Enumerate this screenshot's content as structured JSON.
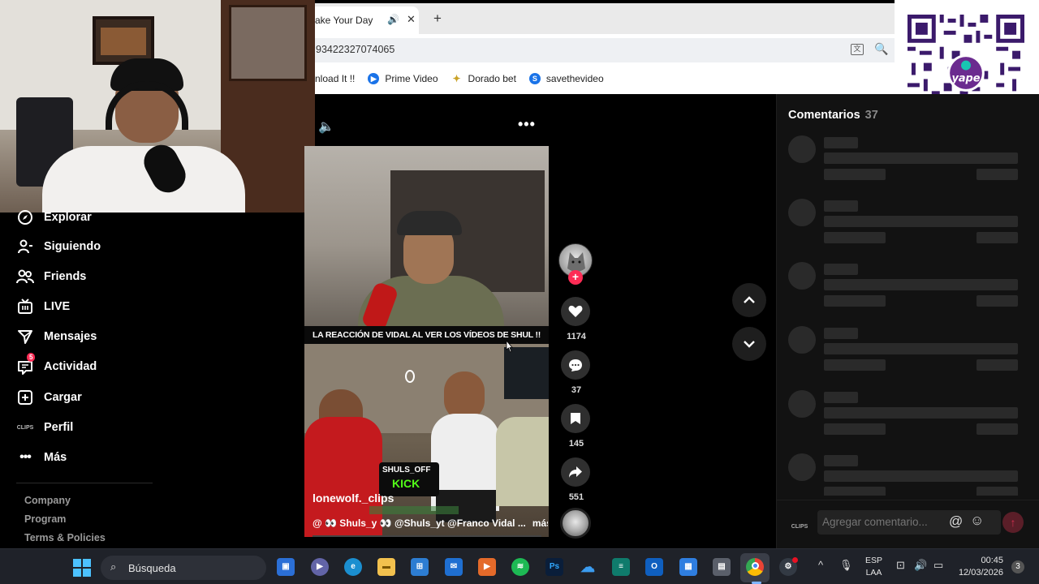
{
  "browser": {
    "tab_title": "ake Your Day",
    "url": "93422327074065",
    "bookmarks": [
      {
        "label": "nload It !!",
        "icon": "bookmark-icon"
      },
      {
        "label": "Prime Video",
        "icon": "play-circle-icon",
        "color": "#1a73e8"
      },
      {
        "label": "Dorado bet",
        "icon": "dorado-icon",
        "color": "#c9a227"
      },
      {
        "label": "savethevideo",
        "icon": "s-circle-icon",
        "color": "#1a73e8"
      }
    ]
  },
  "sidebar": {
    "items": [
      {
        "label": "Explorar",
        "icon": "compass-icon"
      },
      {
        "label": "Siguiendo",
        "icon": "user-follow-icon"
      },
      {
        "label": "Friends",
        "icon": "friends-icon"
      },
      {
        "label": "LIVE",
        "icon": "live-tv-icon"
      },
      {
        "label": "Mensajes",
        "icon": "send-icon"
      },
      {
        "label": "Actividad",
        "icon": "inbox-icon",
        "badge": "5"
      },
      {
        "label": "Cargar",
        "icon": "plus-square-icon"
      },
      {
        "label": "Perfil",
        "icon": "clips-avatar-icon",
        "icon_text": "CLIPS"
      },
      {
        "label": "Más",
        "icon": "more-dots-icon"
      }
    ],
    "footer": [
      "Company",
      "Program",
      "Terms & Policies"
    ]
  },
  "video": {
    "caption": "LA REACCIÓN DE VIDAL AL VER LOS VÍDEOS DE SHUL !!",
    "kick_top": "SHULS_OFF",
    "kick_bottom": "KICK",
    "watermark": "lonewolf._clips",
    "description": "@ 👀 Shuls_y 👀 @Shuls_yt @Franco Vidal ...",
    "more": "más"
  },
  "actions": {
    "likes": "1174",
    "comments": "37",
    "saves": "145",
    "shares": "551"
  },
  "comments": {
    "title": "Comentarios",
    "count": "37",
    "input_placeholder": "Agregar comentario...",
    "clips_text": "CLIPS"
  },
  "taskbar": {
    "search": "Búsqueda",
    "lang_top": "ESP",
    "lang_bottom": "LAA",
    "time": "00:45",
    "date": "12/03/2026",
    "notifications": "3"
  },
  "colors": {
    "accent": "#fe2c55",
    "kick_green": "#53fc18",
    "panel_bg": "#121212"
  }
}
